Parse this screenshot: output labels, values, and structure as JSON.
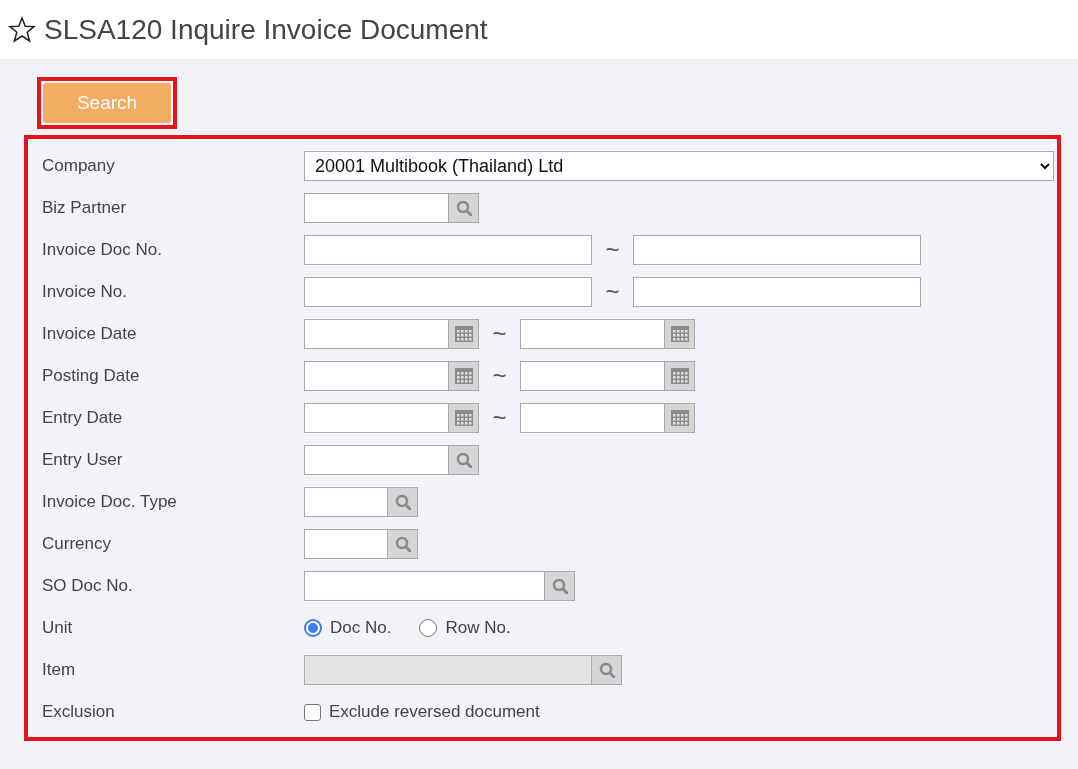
{
  "page": {
    "title": "SLSA120 Inquire Invoice Document",
    "favorite": false
  },
  "search_button": {
    "label": "Search"
  },
  "fields": [
    {
      "kind": "select",
      "label": "Company",
      "value": "20001 Multibook (Thailand) Ltd"
    },
    {
      "kind": "lookup",
      "label": "Biz Partner"
    },
    {
      "kind": "text_range",
      "label": "Invoice Doc No.",
      "separator": "~"
    },
    {
      "kind": "text_range",
      "label": "Invoice No.",
      "separator": "~"
    },
    {
      "kind": "date_range",
      "label": "Invoice Date",
      "separator": "~"
    },
    {
      "kind": "date_range",
      "label": "Posting Date",
      "separator": "~"
    },
    {
      "kind": "date_range",
      "label": "Entry Date",
      "separator": "~"
    },
    {
      "kind": "lookup",
      "label": "Entry User"
    },
    {
      "kind": "code_lookup",
      "label": "Invoice Doc. Type"
    },
    {
      "kind": "code_lookup",
      "label": "Currency"
    },
    {
      "kind": "doc_lookup",
      "label": "SO Doc No."
    },
    {
      "kind": "radio",
      "label": "Unit",
      "options": [
        {
          "label": "Doc No.",
          "selected": true
        },
        {
          "label": "Row No.",
          "selected": false
        }
      ]
    },
    {
      "kind": "wide_lookup",
      "label": "Item",
      "disabled": true
    },
    {
      "kind": "checkbox",
      "label": "Exclusion",
      "option": "Exclude reversed document",
      "checked": false
    }
  ]
}
